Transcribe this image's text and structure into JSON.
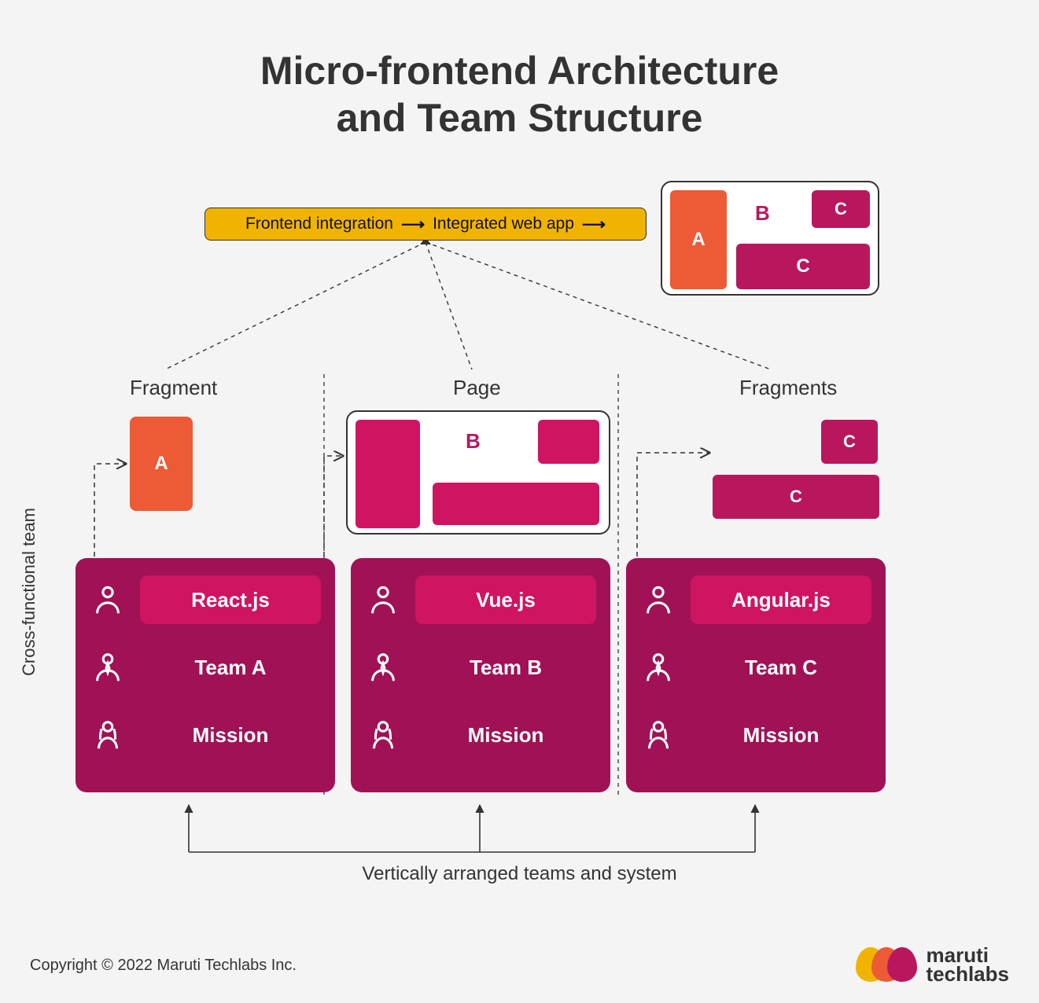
{
  "title_line1": "Micro-frontend Architecture",
  "title_line2": "and Team Structure",
  "pill": {
    "left": "Frontend integration",
    "right": "Integrated web app"
  },
  "mini": {
    "A": "A",
    "B": "B",
    "C1": "C",
    "C2": "C"
  },
  "labels": {
    "colA": "Fragment",
    "colB": "Page",
    "colC": "Fragments",
    "side": "Cross-functional team",
    "bottom": "Vertically arranged teams and system"
  },
  "fragments": {
    "A": "A",
    "B": "B",
    "C1": "C",
    "C2": "C"
  },
  "teams": [
    {
      "framework": "React.js",
      "name": "Team A",
      "mission": "Mission"
    },
    {
      "framework": "Vue.js",
      "name": "Team B",
      "mission": "Mission"
    },
    {
      "framework": "Angular.js",
      "name": "Team C",
      "mission": "Mission"
    }
  ],
  "copyright": "Copyright © 2022 Maruti Techlabs Inc.",
  "logo": {
    "line1": "maruti",
    "line2": "techlabs"
  },
  "colors": {
    "yellow": "#f0b400",
    "orange": "#ec5a36",
    "maroon": "#b8175e",
    "darkmaroon": "#a01255",
    "pink": "#cf1461"
  }
}
